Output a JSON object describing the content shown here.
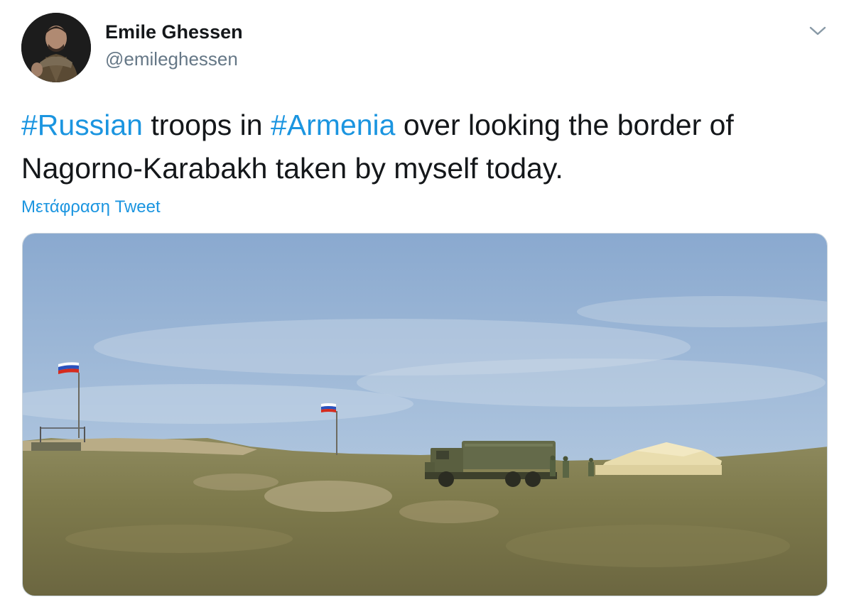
{
  "tweet": {
    "author": {
      "name": "Emile Ghessen",
      "handle": "@emileghessen",
      "avatar_icon": "person-avatar"
    },
    "menu_icon": "chevron-down-icon",
    "text": {
      "hashtag1": "#Russian",
      "part1": " troops in ",
      "hashtag2": "#Armenia",
      "part2": " over looking the border of Nagorno-Karabakh taken by myself today."
    },
    "translate_label": "Μετάφραση Tweet",
    "colors": {
      "link": "#1b95e0",
      "text": "#14171a",
      "secondary": "#657786"
    }
  }
}
